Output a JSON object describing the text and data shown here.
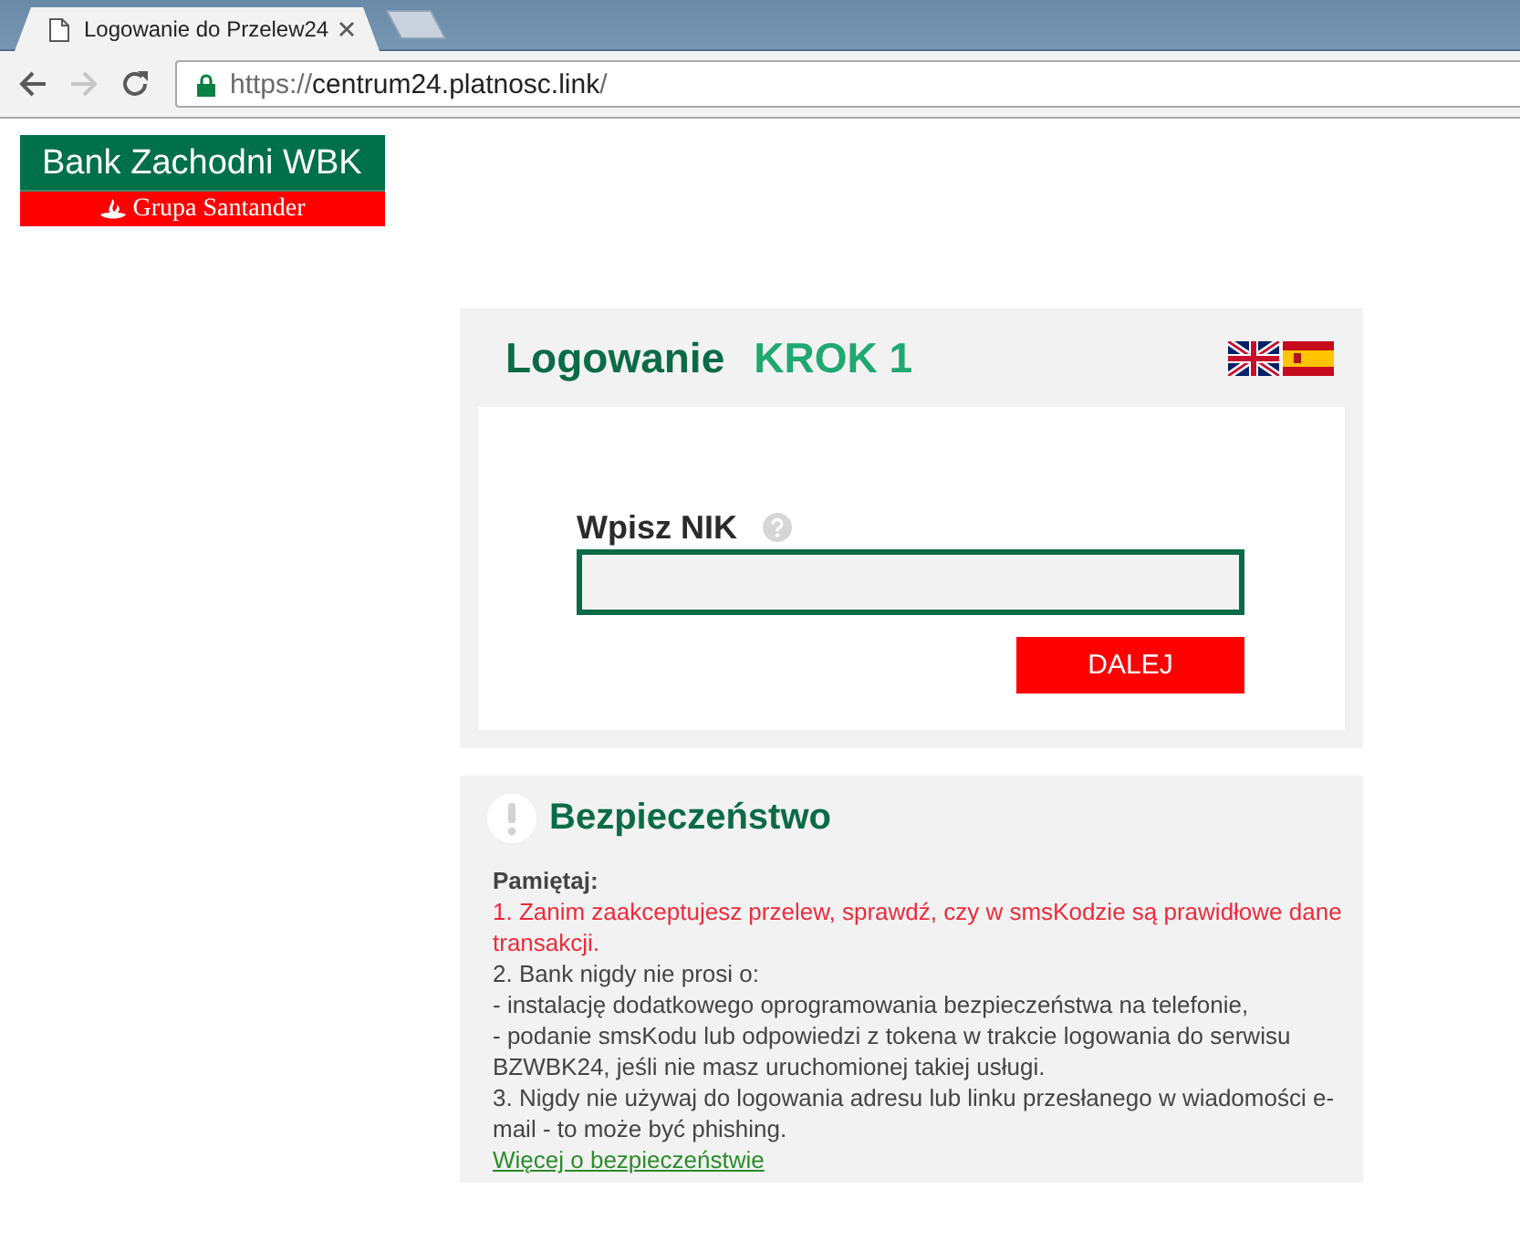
{
  "browser": {
    "tabs": [
      {
        "title": "Logowanie do Przelew24",
        "selected": true
      }
    ],
    "nav_buttons": [
      {
        "kind": "back",
        "disabled": false
      },
      {
        "kind": "forward",
        "disabled": true
      },
      {
        "kind": "reload",
        "disabled": false
      }
    ],
    "address": {
      "scheme": "https://",
      "host": "centrum24.platnosc.link",
      "path": "/"
    }
  },
  "logo": {
    "name": "Bank Zachodni WBK",
    "group": "Grupa Santander"
  },
  "login": {
    "title": "Logowanie",
    "step": "KROK 1",
    "languages": [
      {
        "kind": "en"
      },
      {
        "kind": "es"
      }
    ],
    "field_label": "Wpisz NIK",
    "button": "DALEJ"
  },
  "security": {
    "title": "Bezpieczeństwo",
    "intro": "Pamiętaj:",
    "items": [
      {
        "kind": "warning",
        "text": "1. Zanim zaakceptujesz przelew, sprawdź, czy w smsKodzie są prawidłowe dane transakcji."
      },
      {
        "kind": "info",
        "text": "2. Bank nigdy nie prosi o:"
      },
      {
        "kind": "info",
        "text": "- instalację dodatkowego oprogramowania bezpieczeństwa na telefonie,"
      },
      {
        "kind": "info",
        "text": "- podanie smsKodu lub odpowiedzi z tokena w trakcie logowania do serwisu BZWBK24, jeśli nie masz uruchomionej takiej usługi."
      },
      {
        "kind": "info",
        "text": "3. Nigdy nie używaj do logowania adresu lub linku przesłanego w wiadomości e-mail - to może być phishing."
      }
    ],
    "link": "Więcej o bezpieczeństwie"
  }
}
